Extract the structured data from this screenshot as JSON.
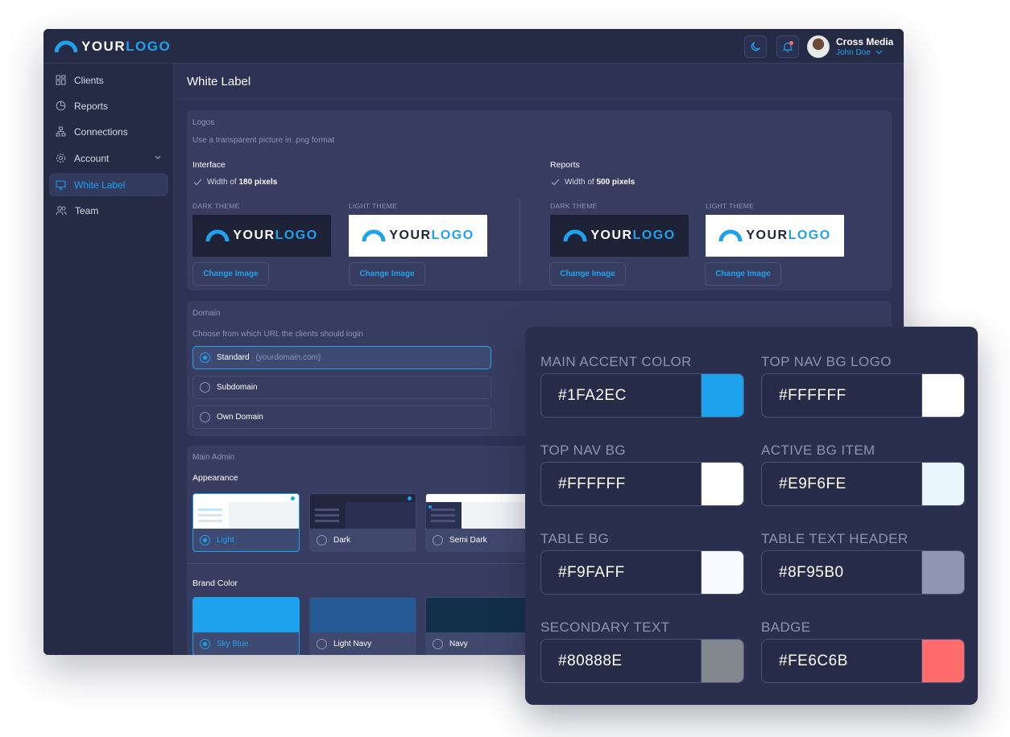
{
  "brand": {
    "logo_main": "YOUR",
    "logo_accent": "LOGO"
  },
  "topbar": {
    "company": "Cross Media",
    "user": "John Doe"
  },
  "sidebar": {
    "items": [
      {
        "label": "Clients",
        "icon": "grid-icon"
      },
      {
        "label": "Reports",
        "icon": "pie-chart-icon"
      },
      {
        "label": "Connections",
        "icon": "hierarchy-icon"
      },
      {
        "label": "Account",
        "icon": "gear-icon"
      },
      {
        "label": "White Label",
        "icon": "monitor-icon",
        "active": true
      },
      {
        "label": "Team",
        "icon": "users-icon"
      }
    ]
  },
  "page": {
    "title": "White Label"
  },
  "logos": {
    "section": "Logos",
    "hint": "Use a transparent picture in .png format",
    "interface": {
      "title": "Interface",
      "width_prefix": "Width of",
      "width_value": "180 pixels"
    },
    "reports": {
      "title": "Reports",
      "width_prefix": "Width of",
      "width_value": "500 pixels"
    },
    "dark_theme": "DARK THEME",
    "light_theme": "LIGHT THEME",
    "change_button": "Change Image"
  },
  "domain": {
    "section": "Domain",
    "hint": "Choose from which URL the clients should login",
    "options": [
      {
        "label": "Standard",
        "sub": "(yourdomain.com)",
        "selected": true
      },
      {
        "label": "Subdomain",
        "sub": "",
        "selected": false
      },
      {
        "label": "Own Domain",
        "sub": "",
        "selected": false
      }
    ]
  },
  "main_admin": {
    "section": "Main Admin",
    "appearance_title": "Appearance",
    "appearance": [
      {
        "label": "Light",
        "selected": true
      },
      {
        "label": "Dark",
        "selected": false
      },
      {
        "label": "Semi Dark",
        "selected": false
      }
    ],
    "brand_color_title": "Brand Color",
    "brand_colors": [
      {
        "label": "Sky Blue",
        "color": "#1FA2EC",
        "selected": true
      },
      {
        "label": "Light Navy",
        "color": "#245B95",
        "selected": false
      },
      {
        "label": "Navy",
        "color": "#123049",
        "selected": false
      }
    ]
  },
  "color_panel": {
    "fields": [
      {
        "label": "MAIN ACCENT COLOR",
        "value": "#1FA2EC"
      },
      {
        "label": "TOP NAV BG LOGO",
        "value": "#FFFFFF"
      },
      {
        "label": "TOP NAV BG",
        "value": "#FFFFFF"
      },
      {
        "label": "ACTIVE BG ITEM",
        "value": "#E9F6FE"
      },
      {
        "label": "TABLE BG",
        "value": "#F9FAFF"
      },
      {
        "label": "TABLE TEXT HEADER",
        "value": "#8F95B0"
      },
      {
        "label": "SECONDARY TEXT",
        "value": "#80888E"
      },
      {
        "label": "BADGE",
        "value": "#FE6C6B"
      }
    ]
  },
  "colors": {
    "accent": "#1FA2EC",
    "badge": "#FE6C6B",
    "window_bg": "#2D3352",
    "card_bg": "#373D60"
  }
}
